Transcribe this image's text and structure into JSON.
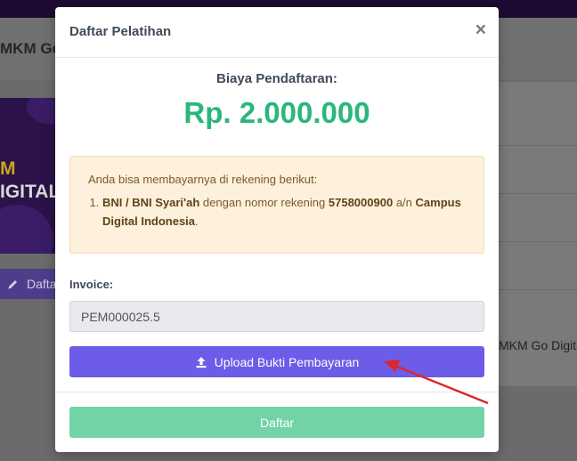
{
  "background": {
    "header_title": "MKM Go",
    "card_text_1": "M",
    "card_text_2": "IGITAL",
    "left_button_label": "Dafta",
    "right_text": "MKM Go Digita"
  },
  "modal": {
    "title": "Daftar Pelatihan",
    "close_label": "×",
    "fee_label": "Biaya Pendaftaran:",
    "fee_amount": "Rp. 2.000.000",
    "info": {
      "intro": "Anda bisa membayarnya di rekening berikut:",
      "bank_name": "BNI / BNI Syari'ah",
      "account_text": "dengan nomor rekening",
      "account_number": "5758000900",
      "account_holder_prefix": "a/n",
      "account_holder": "Campus Digital Indonesia",
      "end_punct": "."
    },
    "invoice_label": "Invoice:",
    "invoice_value": "PEM000025.5",
    "upload_label": "Upload Bukti Pembayaran",
    "submit_label": "Daftar"
  },
  "colors": {
    "accent": "#6c5ce7",
    "fee_green": "#2bb67c",
    "submit_green": "#72d3a6",
    "info_bg": "#fdf0dc",
    "arrow_red": "#e0262b"
  },
  "icons": {
    "upload": "upload-icon",
    "pencil": "pencil-icon",
    "close": "close-icon"
  }
}
